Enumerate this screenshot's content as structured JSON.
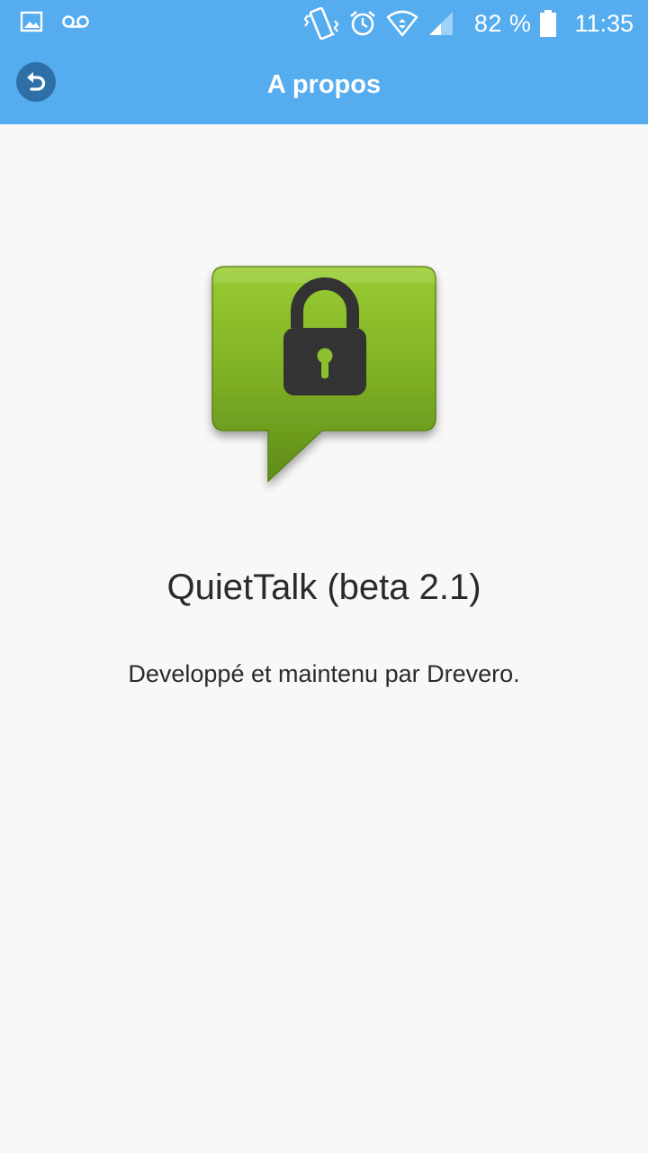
{
  "status_bar": {
    "left_icons": [
      "image-icon",
      "voicemail-icon"
    ],
    "right_icons": [
      "vibrate-icon",
      "alarm-icon",
      "wifi-icon",
      "signal-icon",
      "battery-icon"
    ],
    "battery_text": "82 %",
    "time": "11:35"
  },
  "app_bar": {
    "title": "A propos",
    "back_icon": "undo-arrow-icon",
    "color": "#55acee"
  },
  "content": {
    "logo_icon": "lock-speech-bubble-icon",
    "app_name": "QuietTalk (beta 2.1)",
    "credits": "Developpé et maintenu par Drevero."
  },
  "colors": {
    "app_bar": "#55acee",
    "background": "#f8f8f8",
    "logo_green": "#8dc02f",
    "lock": "#333333"
  }
}
